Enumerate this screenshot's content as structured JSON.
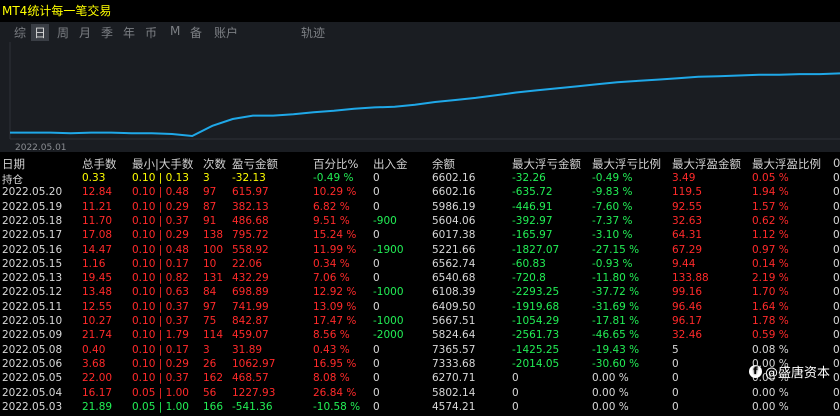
{
  "app": {
    "title": "MT4统计每一笔交易"
  },
  "tabs": [
    {
      "label": "综"
    },
    {
      "label": "日",
      "active": true
    },
    {
      "label": "周"
    },
    {
      "label": "月"
    },
    {
      "label": "季"
    },
    {
      "label": "年"
    },
    {
      "label": "币"
    },
    {
      "label": "M"
    },
    {
      "label": "备"
    },
    {
      "label": "账户"
    },
    {
      "label": "轨迹"
    }
  ],
  "chart_data": {
    "type": "line",
    "x_tick_label": "2022.05.01",
    "line_color": "#1fa8e8",
    "values": [
      0.05,
      0.05,
      0.05,
      0.04,
      0.05,
      0.05,
      0.04,
      0.04,
      0.03,
      0.0,
      0.15,
      0.25,
      0.3,
      0.3,
      0.32,
      0.35,
      0.37,
      0.4,
      0.42,
      0.43,
      0.46,
      0.5,
      0.53,
      0.56,
      0.6,
      0.64,
      0.67,
      0.7,
      0.73,
      0.76,
      0.79,
      0.81,
      0.83,
      0.85,
      0.87,
      0.88,
      0.89,
      0.9,
      0.9,
      0.91,
      0.91,
      0.92
    ]
  },
  "table": {
    "headers": [
      "日期",
      "总手数",
      "最小|大手数",
      "次数",
      "盈亏金额",
      "百分比%",
      "出入金",
      "余额",
      "最大浮亏金额",
      "最大浮亏比例",
      "最大浮盈金额",
      "最大浮盈比例",
      "0"
    ],
    "rows": [
      {
        "c": [
          "持仓",
          "0.33",
          "0.10 | 0.13",
          "3",
          "-32.13",
          "-0.49 %",
          "0",
          "6602.16",
          "-32.26",
          "-0.49 %",
          "3.49",
          "0.05 %",
          "0"
        ],
        "cls": [
          "white",
          "yellow",
          "yellow",
          "yellow",
          "yellow",
          "green",
          "white",
          "white",
          "green",
          "green",
          "red",
          "red",
          "white"
        ]
      },
      {
        "c": [
          "2022.05.20",
          "12.84",
          "0.10 | 0.48",
          "97",
          "615.97",
          "10.29 %",
          "0",
          "6602.16",
          "-635.72",
          "-9.83 %",
          "119.5",
          "1.94 %",
          "0"
        ],
        "cls": [
          "white",
          "red",
          "red",
          "red",
          "red",
          "red",
          "white",
          "white",
          "green",
          "green",
          "red",
          "red",
          "white"
        ]
      },
      {
        "c": [
          "2022.05.19",
          "11.21",
          "0.10 | 0.29",
          "87",
          "382.13",
          "6.82 %",
          "0",
          "5986.19",
          "-446.91",
          "-7.60 %",
          "92.55",
          "1.57 %",
          "0"
        ],
        "cls": [
          "white",
          "red",
          "red",
          "red",
          "red",
          "red",
          "white",
          "white",
          "green",
          "green",
          "red",
          "red",
          "white"
        ]
      },
      {
        "c": [
          "2022.05.18",
          "11.70",
          "0.10 | 0.37",
          "91",
          "486.68",
          "9.51 %",
          "-900",
          "5604.06",
          "-392.97",
          "-7.37 %",
          "32.63",
          "0.62 %",
          "0"
        ],
        "cls": [
          "white",
          "red",
          "red",
          "red",
          "red",
          "red",
          "green",
          "white",
          "green",
          "green",
          "red",
          "red",
          "white"
        ]
      },
      {
        "c": [
          "2022.05.17",
          "17.08",
          "0.10 | 0.29",
          "138",
          "795.72",
          "15.24 %",
          "0",
          "6017.38",
          "-165.97",
          "-3.10 %",
          "64.31",
          "1.12 %",
          "0"
        ],
        "cls": [
          "white",
          "red",
          "red",
          "red",
          "red",
          "red",
          "white",
          "white",
          "green",
          "green",
          "red",
          "red",
          "white"
        ]
      },
      {
        "c": [
          "2022.05.16",
          "14.47",
          "0.10 | 0.48",
          "100",
          "558.92",
          "11.99 %",
          "-1900",
          "5221.66",
          "-1827.07",
          "-27.15 %",
          "67.29",
          "0.97 %",
          "0"
        ],
        "cls": [
          "white",
          "red",
          "red",
          "red",
          "red",
          "red",
          "green",
          "white",
          "green",
          "green",
          "red",
          "red",
          "white"
        ]
      },
      {
        "c": [
          "2022.05.15",
          "1.16",
          "0.10 | 0.17",
          "10",
          "22.06",
          "0.34 %",
          "0",
          "6562.74",
          "-60.83",
          "-0.93 %",
          "9.44",
          "0.14 %",
          "0"
        ],
        "cls": [
          "white",
          "red",
          "red",
          "red",
          "red",
          "red",
          "white",
          "white",
          "green",
          "green",
          "red",
          "red",
          "white"
        ]
      },
      {
        "c": [
          "2022.05.13",
          "19.45",
          "0.10 | 0.82",
          "131",
          "432.29",
          "7.06 %",
          "0",
          "6540.68",
          "-720.8",
          "-11.80 %",
          "133.88",
          "2.19 %",
          "0"
        ],
        "cls": [
          "white",
          "red",
          "red",
          "red",
          "red",
          "red",
          "white",
          "white",
          "green",
          "green",
          "red",
          "red",
          "white"
        ]
      },
      {
        "c": [
          "2022.05.12",
          "13.48",
          "0.10 | 0.63",
          "84",
          "698.89",
          "12.92 %",
          "-1000",
          "6108.39",
          "-2293.25",
          "-37.72 %",
          "99.16",
          "1.70 %",
          "0"
        ],
        "cls": [
          "white",
          "red",
          "red",
          "red",
          "red",
          "red",
          "green",
          "white",
          "green",
          "green",
          "red",
          "red",
          "white"
        ]
      },
      {
        "c": [
          "2022.05.11",
          "12.55",
          "0.10 | 0.37",
          "97",
          "741.99",
          "13.09 %",
          "0",
          "6409.50",
          "-1919.68",
          "-31.69 %",
          "96.46",
          "1.64 %",
          "0"
        ],
        "cls": [
          "white",
          "red",
          "red",
          "red",
          "red",
          "red",
          "white",
          "white",
          "green",
          "green",
          "red",
          "red",
          "white"
        ]
      },
      {
        "c": [
          "2022.05.10",
          "10.27",
          "0.10 | 0.37",
          "75",
          "842.87",
          "17.47 %",
          "-1000",
          "5667.51",
          "-1054.29",
          "-17.81 %",
          "96.17",
          "1.78 %",
          "0"
        ],
        "cls": [
          "white",
          "red",
          "red",
          "red",
          "red",
          "red",
          "green",
          "white",
          "green",
          "green",
          "red",
          "red",
          "white"
        ]
      },
      {
        "c": [
          "2022.05.09",
          "21.74",
          "0.10 | 1.79",
          "114",
          "459.07",
          "8.56 %",
          "-2000",
          "5824.64",
          "-2561.73",
          "-46.65 %",
          "32.46",
          "0.59 %",
          "0"
        ],
        "cls": [
          "white",
          "red",
          "red",
          "red",
          "red",
          "red",
          "green",
          "white",
          "green",
          "green",
          "red",
          "red",
          "white"
        ]
      },
      {
        "c": [
          "2022.05.08",
          "0.40",
          "0.10 | 0.17",
          "3",
          "31.89",
          "0.43 %",
          "0",
          "7365.57",
          "-1425.25",
          "-19.43 %",
          "5",
          "0.08 %",
          "0"
        ],
        "cls": [
          "white",
          "red",
          "red",
          "red",
          "red",
          "red",
          "white",
          "white",
          "green",
          "green",
          "white",
          "white",
          "white"
        ]
      },
      {
        "c": [
          "2022.05.06",
          "3.68",
          "0.10 | 0.29",
          "26",
          "1062.97",
          "16.95 %",
          "0",
          "7333.68",
          "-2014.05",
          "-30.60 %",
          "0",
          "0.00 %",
          "0"
        ],
        "cls": [
          "white",
          "red",
          "red",
          "red",
          "red",
          "red",
          "white",
          "white",
          "green",
          "green",
          "white",
          "white",
          "white"
        ]
      },
      {
        "c": [
          "2022.05.05",
          "22.00",
          "0.10 | 0.37",
          "162",
          "468.57",
          "8.08 %",
          "0",
          "6270.71",
          "0",
          "0.00 %",
          "0",
          "0.00 %",
          "0"
        ],
        "cls": [
          "white",
          "red",
          "red",
          "red",
          "red",
          "red",
          "white",
          "white",
          "white",
          "white",
          "white",
          "white",
          "white"
        ]
      },
      {
        "c": [
          "2022.05.04",
          "16.17",
          "0.05 | 1.00",
          "56",
          "1227.93",
          "26.84 %",
          "0",
          "5802.14",
          "0",
          "0.00 %",
          "0",
          "0.00 %",
          "0"
        ],
        "cls": [
          "white",
          "red",
          "red",
          "red",
          "red",
          "red",
          "white",
          "white",
          "white",
          "white",
          "white",
          "white",
          "white"
        ]
      },
      {
        "c": [
          "2022.05.03",
          "21.89",
          "0.05 | 1.00",
          "166",
          "-541.36",
          "-10.58 %",
          "0",
          "4574.21",
          "0",
          "0.00 %",
          "0",
          "0.00 %",
          "0"
        ],
        "cls": [
          "white",
          "green",
          "green",
          "green",
          "green",
          "green",
          "white",
          "white",
          "white",
          "white",
          "white",
          "white",
          "white"
        ]
      }
    ]
  },
  "watermark": {
    "text": "@盛唐资本",
    "icon": "weibo-icon"
  }
}
